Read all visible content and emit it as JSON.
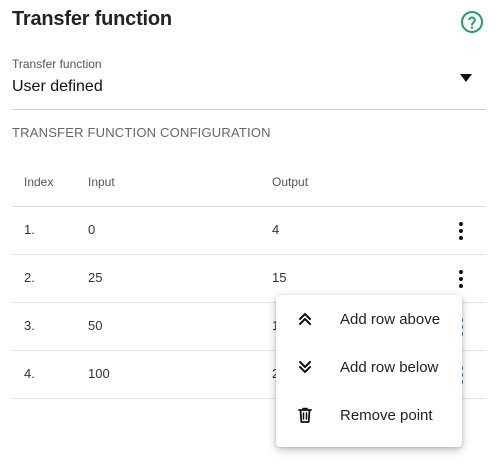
{
  "header": {
    "title": "Transfer function",
    "help_icon": "help-circle-icon",
    "help_color": "#1fa05b"
  },
  "select": {
    "label": "Transfer function",
    "value": "User defined"
  },
  "section": {
    "title": "TRANSFER FUNCTION CONFIGURATION"
  },
  "table": {
    "columns": [
      "Index",
      "Input",
      "Output"
    ],
    "rows": [
      {
        "index": "1.",
        "input": "0",
        "output": "4"
      },
      {
        "index": "2.",
        "input": "25",
        "output": "15"
      },
      {
        "index": "3.",
        "input": "50",
        "output": "1"
      },
      {
        "index": "4.",
        "input": "100",
        "output": "2"
      }
    ]
  },
  "menu": {
    "items": [
      {
        "label": "Add row above",
        "icon": "double-chevron-up-icon"
      },
      {
        "label": "Add row below",
        "icon": "double-chevron-down-icon"
      },
      {
        "label": "Remove point",
        "icon": "trash-icon"
      }
    ]
  }
}
